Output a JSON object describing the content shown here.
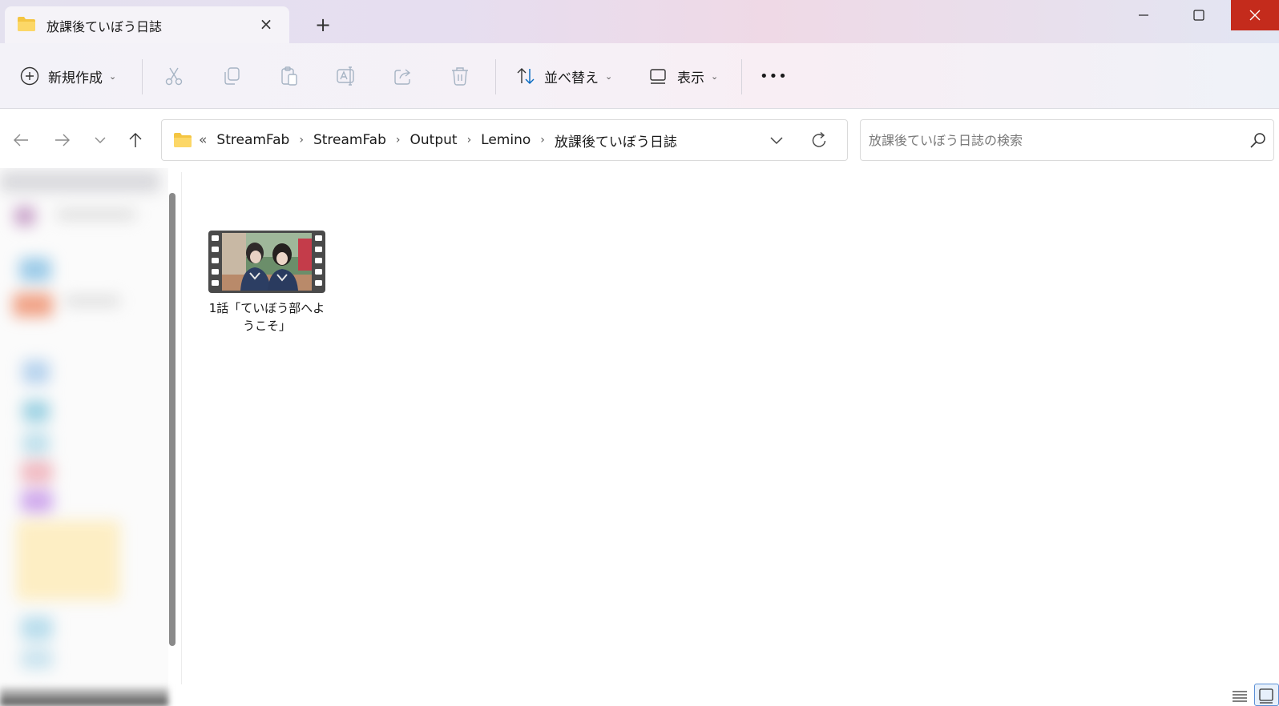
{
  "window": {
    "tab_title": "放課後ていぼう日誌",
    "tab_icon": "folder-icon",
    "new_tab_label": "+",
    "close_label": "×",
    "close_color": "#c42b1c"
  },
  "toolbar": {
    "new_label": "新規作成",
    "sort_label": "並べ替え",
    "view_label": "表示",
    "more_label": "•••",
    "accent": "#0067c0"
  },
  "address": {
    "overflow_label": "«",
    "crumbs": [
      "StreamFab",
      "StreamFab",
      "Output",
      "Lemino",
      "放課後ていぼう日誌"
    ]
  },
  "search": {
    "placeholder": "放課後ていぼう日誌の検索",
    "value": ""
  },
  "files": [
    {
      "name": "1話「ていぼう部へようこそ」",
      "type": "video"
    }
  ]
}
